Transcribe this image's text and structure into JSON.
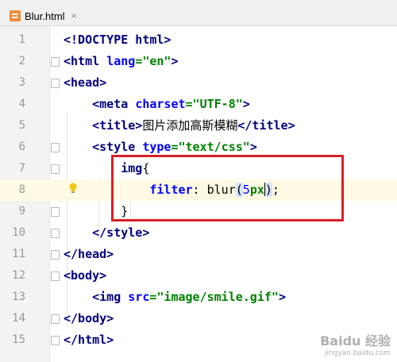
{
  "tab": {
    "title": "Blur.html",
    "close_icon": "×"
  },
  "lines": [
    {
      "n": "1",
      "text": "<!DOCTYPE html>"
    },
    {
      "n": "2",
      "text": "<html lang=\"en\">"
    },
    {
      "n": "3",
      "text": "<head>"
    },
    {
      "n": "4",
      "text": "    <meta charset=\"UTF-8\">"
    },
    {
      "n": "5",
      "text": "    <title>图片添加高斯模糊</title>"
    },
    {
      "n": "6",
      "text": "    <style type=\"text/css\">"
    },
    {
      "n": "7",
      "text": "        img{"
    },
    {
      "n": "8",
      "text": "            filter: blur(5px);"
    },
    {
      "n": "9",
      "text": "        }"
    },
    {
      "n": "10",
      "text": "    </style>"
    },
    {
      "n": "11",
      "text": "</head>"
    },
    {
      "n": "12",
      "text": "<body>"
    },
    {
      "n": "13",
      "text": "    <img src=\"image/smile.gif\">"
    },
    {
      "n": "14",
      "text": "</body>"
    },
    {
      "n": "15",
      "text": "</html>"
    }
  ],
  "current_line": "8",
  "watermark": {
    "line1": "Baidu 经验",
    "line2": "jingyan.baidu.com"
  },
  "colors": {
    "annotation_box": "#d81f26",
    "current_line_bg": "#fffae3"
  }
}
